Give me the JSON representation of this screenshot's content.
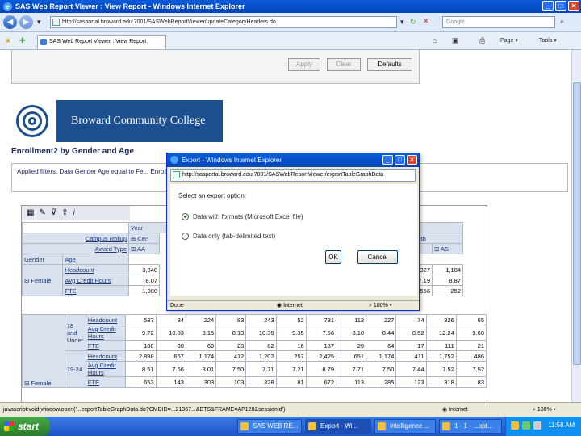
{
  "window": {
    "title": "SAS Web Report Viewer : View Report - Windows Internet Explorer"
  },
  "address_bar": {
    "url": "http://sasportal.broward.edu:7001/SASWebReportViewer/updateCategoryHeaders.do",
    "search_placeholder": "Google"
  },
  "tab": {
    "label": "SAS Web Report Viewer : View Report"
  },
  "toolbar": {
    "page_label": "Page",
    "tools_label": "Tools"
  },
  "filter_buttons": {
    "apply": "Apply",
    "clear": "Clear",
    "defaults": "Defaults"
  },
  "logo": {
    "text": "Broward Community College"
  },
  "report": {
    "title": "Enrollment2 by Gender and Age",
    "applied_filters_text": "Applied filters: Data Gender Age equal to Fe... Enrolled equal to Yes AND Award Type equal to AA, AS",
    "rollup_label": "Campus Rollup",
    "year_label": "Year",
    "award_type_label": "Award Type",
    "gender_label": "Gender",
    "age_label": "Age",
    "campus_partial": "Cen",
    "campus_south": "South",
    "aa": "AA",
    "as": "AS"
  },
  "grid": {
    "female_label": "Female",
    "female_rows": [
      {
        "label": "Headcount",
        "v1": "3,840",
        "s1": "2,327",
        "s2": "1,104"
      },
      {
        "label": "Avg Credit Hours",
        "v1": "8.07",
        "s1": "7.19",
        "s2": "8.87"
      },
      {
        "label": "FTE",
        "v1": "1,000",
        "s1": "556",
        "s2": "252"
      }
    ],
    "age_18_label": "18 and Under",
    "age_1924_label": "19-24",
    "female_sub_label": "Female",
    "rows_18": [
      {
        "label": "Headcount",
        "vals": [
          "587",
          "84",
          "224",
          "83",
          "243",
          "52",
          "731",
          "113",
          "227",
          "74",
          "326",
          "65"
        ]
      },
      {
        "label": "Avg Credit Hours",
        "vals": [
          "9.72",
          "10.83",
          "9.15",
          "8.13",
          "10.39",
          "9.35",
          "7.56",
          "8.10",
          "8.44",
          "8.52",
          "12.24",
          "9.60"
        ]
      },
      {
        "label": "FTE",
        "vals": [
          "188",
          "30",
          "69",
          "23",
          "82",
          "16",
          "187",
          "29",
          "64",
          "17",
          "111",
          "21"
        ]
      }
    ],
    "rows_1924": [
      {
        "label": "Headcount",
        "vals": [
          "2,898",
          "657",
          "1,174",
          "412",
          "1,202",
          "257",
          "2,425",
          "651",
          "1,174",
          "411",
          "1,752",
          "486"
        ]
      },
      {
        "label": "Avg Credit Hours",
        "vals": [
          "8.51",
          "7.56",
          "8.01",
          "7.50",
          "7.71",
          "7.21",
          "8.79",
          "7.71",
          "7.50",
          "7.44",
          "7.52",
          "7.52"
        ]
      },
      {
        "label": "FTE",
        "vals": [
          "653",
          "143",
          "303",
          "103",
          "328",
          "81",
          "672",
          "113",
          "285",
          "123",
          "318",
          "83"
        ]
      }
    ]
  },
  "dialog": {
    "title": "Export - Windows Internet Explorer",
    "url": "http://sasportal.broward.edu:7001/SASWebReportViewer/exportTableGraphData",
    "prompt": "Select an export option:",
    "option1": "Data with formats (Microsoft Excel file)",
    "option2": "Data only (tab-delimited text)",
    "ok": "OK",
    "cancel": "Cancel",
    "status_done": "Done",
    "status_zone": "Internet",
    "status_zoom": "100%"
  },
  "statusbar": {
    "text": "javascript:void(window.open('...exportTableGraphData.do?CMDID=...21367...&ETS&FRAME=AP128&sessionId')",
    "zone": "Internet",
    "zoom": "100%"
  },
  "taskbar": {
    "start": "start",
    "tasks": [
      "SAS WEB RE...",
      "Export - Wi...",
      "Intelligence ...",
      "1 - 1 - ...ppt..."
    ],
    "clock": "11:58 AM"
  }
}
